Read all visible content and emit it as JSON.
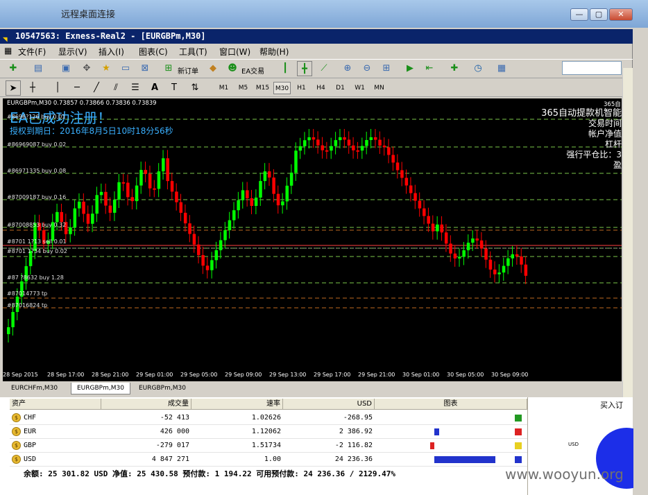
{
  "rdp": {
    "title": "远程桌面连接",
    "buttons": [
      "—",
      "▢",
      "✕"
    ]
  },
  "window": {
    "title": "10547563: Exness-Real2 - [EURGBPm,M30]"
  },
  "menu": [
    "文件(F)",
    "显示(V)",
    "插入(I)",
    "图表(C)",
    "工具(T)",
    "窗口(W)",
    "帮助(H)"
  ],
  "toolbar": {
    "new_order": "新订单",
    "ea_trading": "EA交易"
  },
  "timeframes": [
    "M1",
    "M5",
    "M15",
    "M30",
    "H1",
    "H4",
    "D1",
    "W1",
    "MN"
  ],
  "active_timeframe": "M30",
  "chart": {
    "info": "EURGBPm,M30  0.73857 0.73866 0.73836 0.73839",
    "corner_label": "365自",
    "ea_title": "EA已成功注册！",
    "auth": "授权到期日：2016年8月5日10时18分56秒",
    "right_lines": [
      "365自动提款机智能",
      "交易时间",
      "帐户净值",
      "杠杆",
      "强行平仓比：3",
      "盈"
    ],
    "orders": [
      "#8696?126 buy 0.01",
      "#86969087 buy 0.02",
      "#86971335 buy 0.08",
      "#87009187 buy 0.16",
      "#87008853 buy 0.32",
      "#8701 1?13 sell 0.01",
      "#8701 1?34 buy 0.02",
      "#87 ?8632 buy 1.28",
      "#87014773 tp",
      "#87016824 tp"
    ]
  },
  "chart_data": {
    "type": "candlestick",
    "symbol": "EURGBPm",
    "timeframe": "M30",
    "ohlc": {
      "open": 0.73857,
      "high": 0.73866,
      "low": 0.73836,
      "close": 0.73839
    },
    "x_ticks": [
      "28 Sep 2015",
      "28 Sep 17:00",
      "28 Sep 21:00",
      "29 Sep 01:00",
      "29 Sep 05:00",
      "29 Sep 09:00",
      "29 Sep 13:00",
      "29 Sep 17:00",
      "29 Sep 21:00",
      "30 Sep 01:00",
      "30 Sep 05:00",
      "30 Sep 09:00"
    ],
    "colors": {
      "bull": "#00ff00",
      "bear": "#ff0000",
      "background": "#000000"
    }
  },
  "chart_tabs": [
    "EURCHFm,M30",
    "EURGBPm,M30",
    "EURGBPm,M30"
  ],
  "active_chart_tab": 1,
  "terminal": {
    "headers": [
      "资产",
      "成交量",
      "速率",
      "USD",
      "图表"
    ],
    "rows": [
      {
        "asset": "CHF",
        "volume": "-52 413",
        "rate": "1.02626",
        "usd": "-268.95",
        "bar": 0,
        "dir": "neg",
        "color": "#229922"
      },
      {
        "asset": "EUR",
        "volume": "426 000",
        "rate": "1.12062",
        "usd": "2 386.92",
        "bar": 0.08,
        "dir": "pos",
        "color": "#dd2222"
      },
      {
        "asset": "GBP",
        "volume": "-279 017",
        "rate": "1.51734",
        "usd": "-2 116.82",
        "bar": 0.07,
        "dir": "neg",
        "color": "#e8d020"
      },
      {
        "asset": "USD",
        "volume": "4 847 271",
        "rate": "1.00",
        "usd": "24 236.36",
        "bar": 1.0,
        "dir": "pos",
        "color": "#2233cc"
      }
    ],
    "balance": "余额: 25 301.82 USD  净值: 25 430.58  预付款: 1 194.22  可用预付款: 24 236.36 / 2129.47%",
    "right_title": "买入订",
    "pie_label": "USD"
  },
  "watermark": "www.wooyun.org"
}
